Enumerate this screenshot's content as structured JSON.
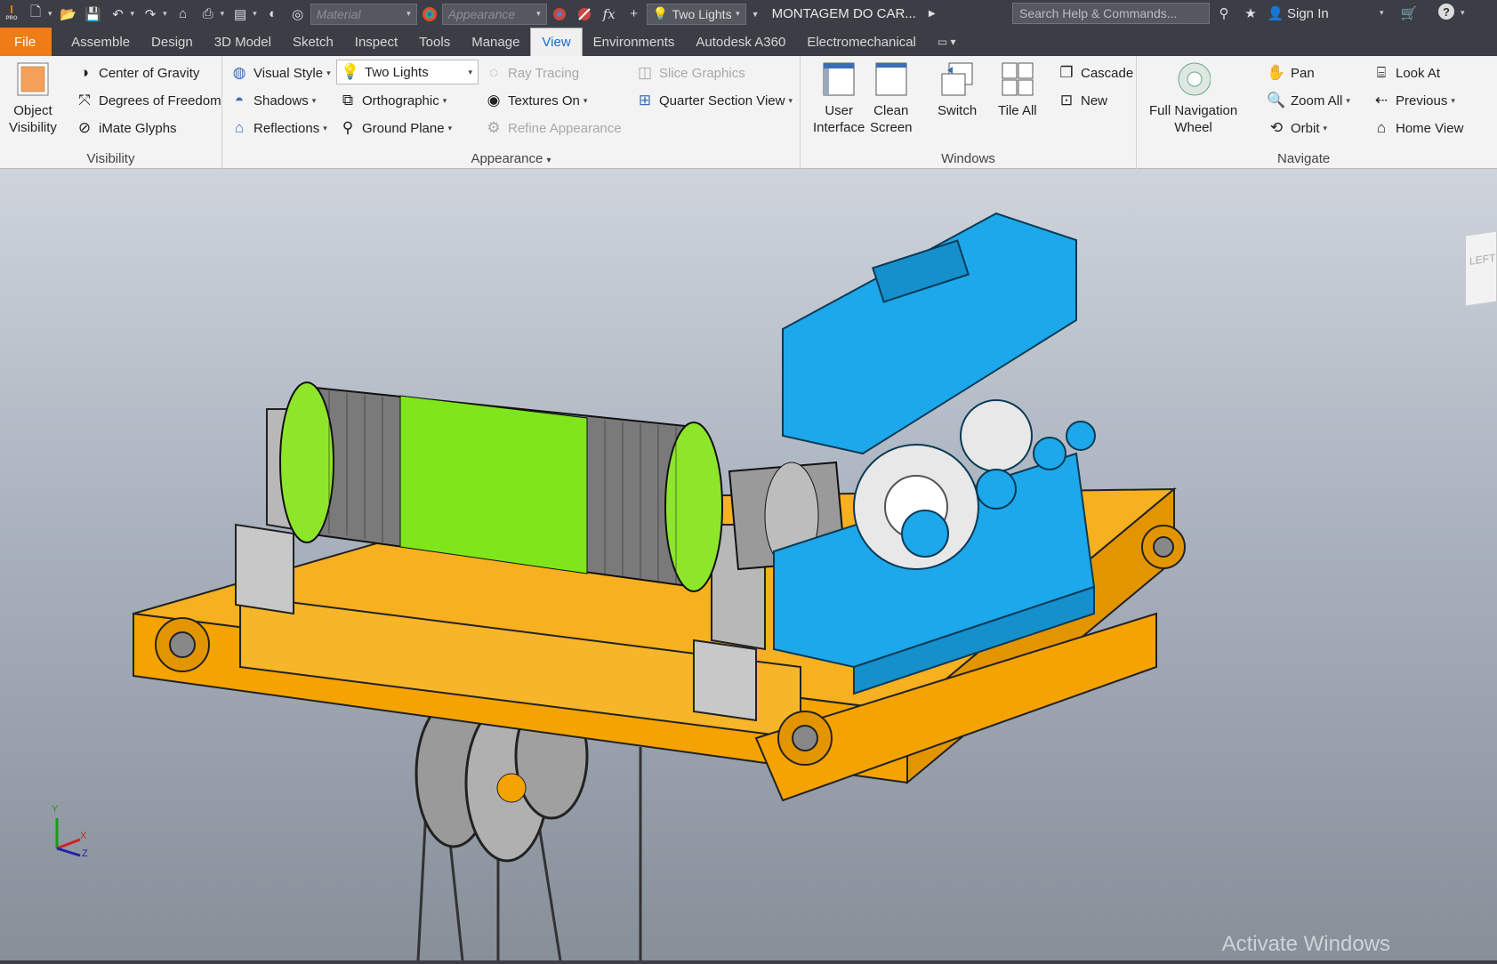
{
  "qat": {
    "app_badge": "PRO",
    "material_placeholder": "Material",
    "appearance_placeholder": "Appearance",
    "fx_label": "fx",
    "lights_value": "Two Lights",
    "doc_title": "MONTAGEM DO CAR...",
    "search_placeholder": "Search Help & Commands...",
    "sign_in": "Sign In",
    "help_glyph": "?"
  },
  "tabs": [
    "File",
    "Assemble",
    "Design",
    "3D Model",
    "Sketch",
    "Inspect",
    "Tools",
    "Manage",
    "View",
    "Environments",
    "Autodesk A360",
    "Electromechanical"
  ],
  "active_tab": "View",
  "ribbon": {
    "visibility": {
      "title": "Visibility",
      "object_visibility": [
        "Object",
        "Visibility"
      ],
      "center_of_gravity": "Center of Gravity",
      "degrees_of_freedom": "Degrees of Freedom",
      "imate_glyphs": "iMate Glyphs"
    },
    "appearance": {
      "title": "Appearance",
      "visual_style": "Visual Style",
      "lighting": "Two Lights",
      "ray_tracing": "Ray Tracing",
      "slice_graphics": "Slice Graphics",
      "shadows": "Shadows",
      "orthographic": "Orthographic",
      "textures_on": "Textures On",
      "quarter_section_view": "Quarter Section View",
      "reflections": "Reflections",
      "ground_plane": "Ground Plane",
      "refine_appearance": "Refine Appearance"
    },
    "windows": {
      "title": "Windows",
      "user_interface": [
        "User",
        "Interface"
      ],
      "clean_screen": [
        "Clean",
        "Screen"
      ],
      "switch": "Switch",
      "tile_all": "Tile All",
      "cascade": "Cascade",
      "new": "New"
    },
    "navigate": {
      "title": "Navigate",
      "full_navigation_wheel": [
        "Full Navigation",
        "Wheel"
      ],
      "pan": "Pan",
      "zoom_all": "Zoom All",
      "orbit": "Orbit",
      "look_at": "Look At",
      "previous": "Previous",
      "home_view": "Home View"
    }
  },
  "viewport": {
    "viewcube_face": "LEFT",
    "axes": [
      "Y",
      "X",
      "Z"
    ],
    "watermark": "Activate Windows"
  },
  "colors": {
    "accent": "#ef7c16",
    "frame": "#f5a300",
    "gearbox": "#1ca8ea",
    "drum_band": "#7ee61a",
    "flange": "#8ee62a"
  }
}
